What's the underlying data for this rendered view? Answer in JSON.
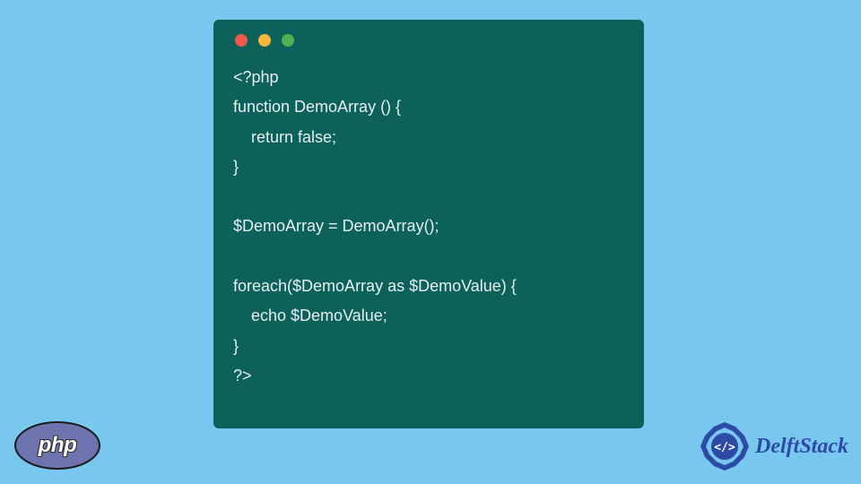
{
  "code_window": {
    "traffic_lights": [
      "red",
      "yellow",
      "green"
    ],
    "code_lines": [
      "<?php",
      "function DemoArray () {",
      "    return false;",
      "}",
      "",
      "$DemoArray = DemoArray();",
      "",
      "foreach($DemoArray as $DemoValue) {",
      "    echo $DemoValue;",
      "}",
      "?>"
    ]
  },
  "php_logo": {
    "text": "php"
  },
  "delftstack_logo": {
    "text": "DelftStack",
    "badge_inner": "</>"
  }
}
